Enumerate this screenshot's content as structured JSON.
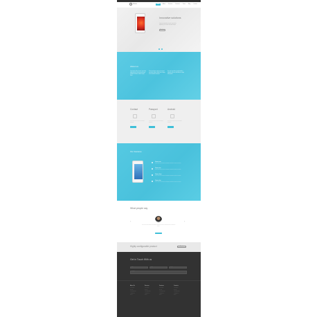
{
  "header": {
    "logo_text": "Mobile",
    "nav": [
      "Home",
      "About",
      "Services",
      "Features",
      "Team",
      "Blog",
      "Contact"
    ],
    "active_nav": "Home"
  },
  "hero": {
    "title": "Innovative solutions",
    "description": "Lorem ipsum dolor sit amet, consectetur adipiscing elit. Sed do eiusmod tempor.",
    "button": "Read more"
  },
  "about": {
    "title": "About us",
    "columns": [
      "Lorem ipsum dolor sit amet, consectetur adipiscing elit, sed do eiusmod tempor incididunt ut labore et dolore magna aliqua.",
      "Ut enim ad minim veniam, quis nostrud exercitation ullamco laboris nisi ut aliquip ex ea commodo consequat.",
      "Duis aute irure dolor in reprehenderit in voluptate velit esse cillum dolore eu fugiat nulla pariatur."
    ]
  },
  "services": {
    "items": [
      {
        "title": "Contact",
        "text": "Lorem ipsum dolor sit amet consectetur adipiscing",
        "button": "More"
      },
      {
        "title": "Passport",
        "text": "Lorem ipsum dolor sit amet consectetur adipiscing",
        "button": "More"
      },
      {
        "title": "Android",
        "text": "Lorem ipsum dolor sit amet consectetur adipiscing",
        "button": "More"
      }
    ]
  },
  "features": {
    "title": "Our features",
    "items": [
      {
        "title": "Feature one",
        "text": "Lorem ipsum dolor sit amet, consectetur adipiscing elit sed do eiusmod."
      },
      {
        "title": "Feature two",
        "text": "Lorem ipsum dolor sit amet, consectetur adipiscing elit sed do eiusmod."
      },
      {
        "title": "Feature three",
        "text": "Lorem ipsum dolor sit amet, consectetur adipiscing elit sed do eiusmod."
      },
      {
        "title": "Feature four",
        "text": "Lorem ipsum dolor sit amet, consectetur adipiscing elit sed do eiusmod."
      }
    ]
  },
  "testimonials": {
    "title": "What people say",
    "prev": "‹",
    "next": "›",
    "quote": "Lorem ipsum dolor sit amet, consectetur adipiscing elit, sed do eiusmod tempor incididunt ut labore."
  },
  "banner": {
    "text": "Highly configurable product",
    "button": "Buy now"
  },
  "footer": {
    "title": "Get in Touch With us",
    "inputs": [
      "Name",
      "Email",
      "Subject",
      "Message"
    ],
    "columns": [
      {
        "title": "About Us",
        "items": [
          "Lorem ipsum",
          "Dolor sit",
          "Amet consectetur",
          "Adipiscing elit",
          "Sed do"
        ]
      },
      {
        "title": "Services",
        "items": [
          "Lorem ipsum",
          "Dolor sit",
          "Amet consectetur",
          "Adipiscing elit",
          "Sed do"
        ]
      },
      {
        "title": "Features",
        "items": [
          "Lorem ipsum",
          "Dolor sit",
          "Amet consectetur",
          "Adipiscing elit",
          "Sed do"
        ]
      },
      {
        "title": "Contacts",
        "items": [
          "Lorem ipsum",
          "Dolor sit",
          "Amet consectetur",
          "Adipiscing elit",
          "Sed do"
        ]
      }
    ]
  },
  "colors": {
    "accent": "#3ebfd8",
    "footer": "#323232",
    "hero_bg": "#efefef"
  }
}
